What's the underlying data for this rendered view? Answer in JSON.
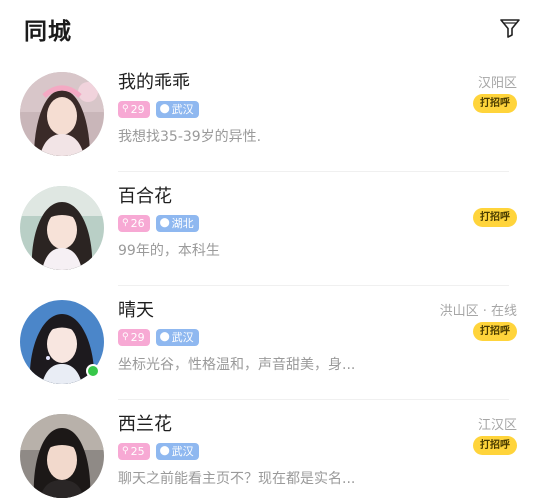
{
  "header": {
    "title": "同城",
    "filter_icon": "filter-icon"
  },
  "colors": {
    "age_tag": "#f7a9d4",
    "location_tag": "#8fb8f0",
    "greet_button": "#ffd43b",
    "online": "#37c749"
  },
  "users": [
    {
      "name": "我的乖乖",
      "age": "29",
      "location": "武汉",
      "bio": "我想找35-39岁的异性.",
      "meta": "汉阳区",
      "action": "打招呼",
      "online": false
    },
    {
      "name": "百合花",
      "age": "26",
      "location": "湖北",
      "bio": "99年的，本科生",
      "meta": "",
      "action": "打招呼",
      "online": false
    },
    {
      "name": "晴天",
      "age": "29",
      "location": "武汉",
      "bio": "坐标光谷，性格温和，声音甜美，身...",
      "meta": "洪山区 · 在线",
      "action": "打招呼",
      "online": true
    },
    {
      "name": "西兰花",
      "age": "25",
      "location": "武汉",
      "bio": "聊天之前能看主页不？现在都是实名...",
      "meta": "江汉区",
      "action": "打招呼",
      "online": false
    }
  ]
}
